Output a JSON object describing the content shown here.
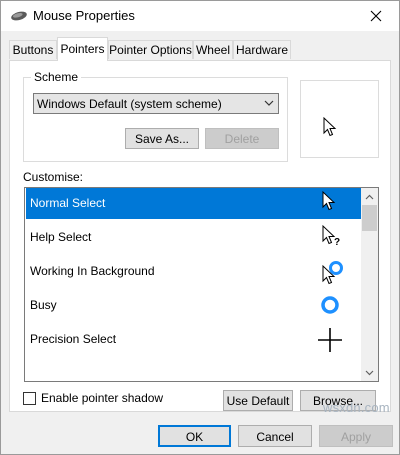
{
  "window": {
    "title": "Mouse Properties",
    "close_glyph": "✕"
  },
  "tabs": [
    {
      "label": "Buttons",
      "active": false
    },
    {
      "label": "Pointers",
      "active": true
    },
    {
      "label": "Pointer Options",
      "active": false
    },
    {
      "label": "Wheel",
      "active": false
    },
    {
      "label": "Hardware",
      "active": false
    }
  ],
  "scheme": {
    "label": "Scheme",
    "selected": "Windows Default (system scheme)",
    "save_as_label": "Save As...",
    "delete_label": "Delete"
  },
  "customise": {
    "label": "Customise:",
    "items": [
      {
        "label": "Normal Select",
        "icon": "arrow-cursor-icon",
        "selected": true
      },
      {
        "label": "Help Select",
        "icon": "help-cursor-icon",
        "selected": false
      },
      {
        "label": "Working In Background",
        "icon": "working-cursor-icon",
        "selected": false
      },
      {
        "label": "Busy",
        "icon": "busy-cursor-icon",
        "selected": false
      },
      {
        "label": "Precision Select",
        "icon": "crosshair-cursor-icon",
        "selected": false
      }
    ]
  },
  "pointer_shadow": {
    "label": "Enable pointer shadow",
    "checked": false
  },
  "buttons": {
    "use_default": "Use Default",
    "browse": "Browse...",
    "ok": "OK",
    "cancel": "Cancel",
    "apply": "Apply"
  },
  "watermark": "wsxdn.com",
  "colors": {
    "selection": "#0078d7",
    "busy_ring": "#1e90ff"
  }
}
